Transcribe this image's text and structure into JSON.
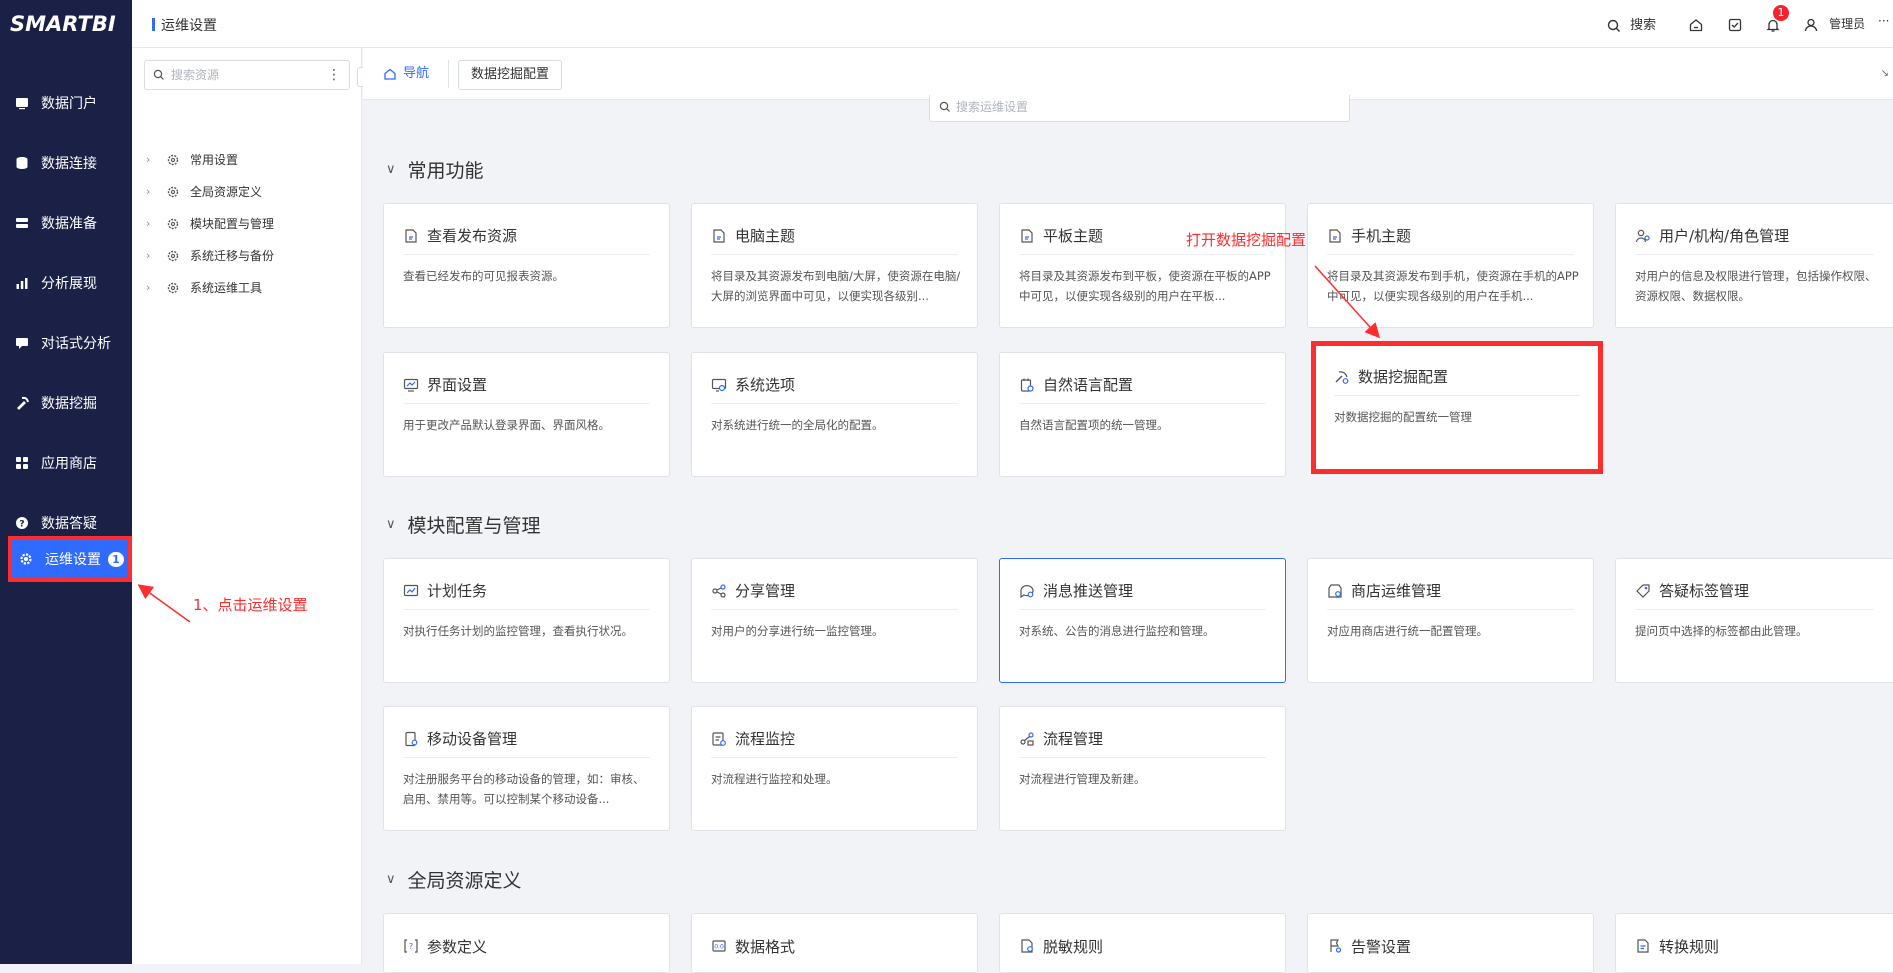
{
  "app": {
    "logo": "SMARTBI",
    "page_title": "运维设置"
  },
  "topbar": {
    "search_label": "搜索",
    "notification_count": "1",
    "user_label": "管理员",
    "more_label": "···"
  },
  "sidebar": {
    "items": [
      {
        "label": "数据门户"
      },
      {
        "label": "数据连接"
      },
      {
        "label": "数据准备"
      },
      {
        "label": "分析展现"
      },
      {
        "label": "对话式分析"
      },
      {
        "label": "数据挖掘"
      },
      {
        "label": "应用商店"
      },
      {
        "label": "数据答疑"
      },
      {
        "label": "运维设置",
        "badge": "1"
      }
    ]
  },
  "tree": {
    "search_placeholder": "搜索资源",
    "more": "⋮",
    "items": [
      {
        "label": "常用设置"
      },
      {
        "label": "全局资源定义"
      },
      {
        "label": "模块配置与管理"
      },
      {
        "label": "系统迁移与备份"
      },
      {
        "label": "系统运维工具"
      }
    ]
  },
  "tabs": {
    "nav_label": "导航",
    "tab_label": "数据挖掘配置"
  },
  "content": {
    "search_placeholder": "搜索运维设置",
    "sections": [
      {
        "title": "常用功能",
        "cards": [
          {
            "title": "查看发布资源",
            "desc": "查看已经发布的可见报表资源。"
          },
          {
            "title": "电脑主题",
            "desc": "将目录及其资源发布到电脑/大屏，使资源在电脑/大屏的浏览界面中可见，以便实现各级别..."
          },
          {
            "title": "平板主题",
            "desc": "将目录及其资源发布到平板，使资源在平板的APP中可见，以便实现各级别的用户在平板..."
          },
          {
            "title": "手机主题",
            "desc": "将目录及其资源发布到手机，使资源在手机的APP中可见，以便实现各级别的用户在手机..."
          },
          {
            "title": "用户/机构/角色管理",
            "desc": "对用户的信息及权限进行管理，包括操作权限、资源权限、数据权限。"
          },
          {
            "title": "界面设置",
            "desc": "用于更改产品默认登录界面、界面风格。"
          },
          {
            "title": "系统选项",
            "desc": "对系统进行统一的全局化的配置。"
          },
          {
            "title": "自然语言配置",
            "desc": "自然语言配置项的统一管理。"
          },
          {
            "title": "数据挖掘配置",
            "desc": "对数据挖掘的配置统一管理"
          }
        ]
      },
      {
        "title": "模块配置与管理",
        "cards": [
          {
            "title": "计划任务",
            "desc": "对执行任务计划的监控管理，查看执行状况。"
          },
          {
            "title": "分享管理",
            "desc": "对用户的分享进行统一监控管理。"
          },
          {
            "title": "消息推送管理",
            "desc": "对系统、公告的消息进行监控和管理。"
          },
          {
            "title": "商店运维管理",
            "desc": "对应用商店进行统一配置管理。"
          },
          {
            "title": "答疑标签管理",
            "desc": "提问页中选择的标签都由此管理。"
          },
          {
            "title": "移动设备管理",
            "desc": "对注册服务平台的移动设备的管理，如：审核、启用、禁用等。可以控制某个移动设备..."
          },
          {
            "title": "流程监控",
            "desc": "对流程进行监控和处理。"
          },
          {
            "title": "流程管理",
            "desc": "对流程进行管理及新建。"
          }
        ]
      },
      {
        "title": "全局资源定义",
        "cards": [
          {
            "title": "参数定义"
          },
          {
            "title": "数据格式"
          },
          {
            "title": "脱敏规则"
          },
          {
            "title": "告警设置"
          },
          {
            "title": "转换规则"
          }
        ]
      }
    ]
  },
  "annotations": {
    "step1": "1、点击运维设置",
    "step2": "打开数据挖掘配置",
    "color": "#ff2d2d"
  },
  "colors": {
    "sidebar_bg": "#1b2146",
    "accent": "#2f6bff",
    "content_bg": "#f1f3f7"
  }
}
